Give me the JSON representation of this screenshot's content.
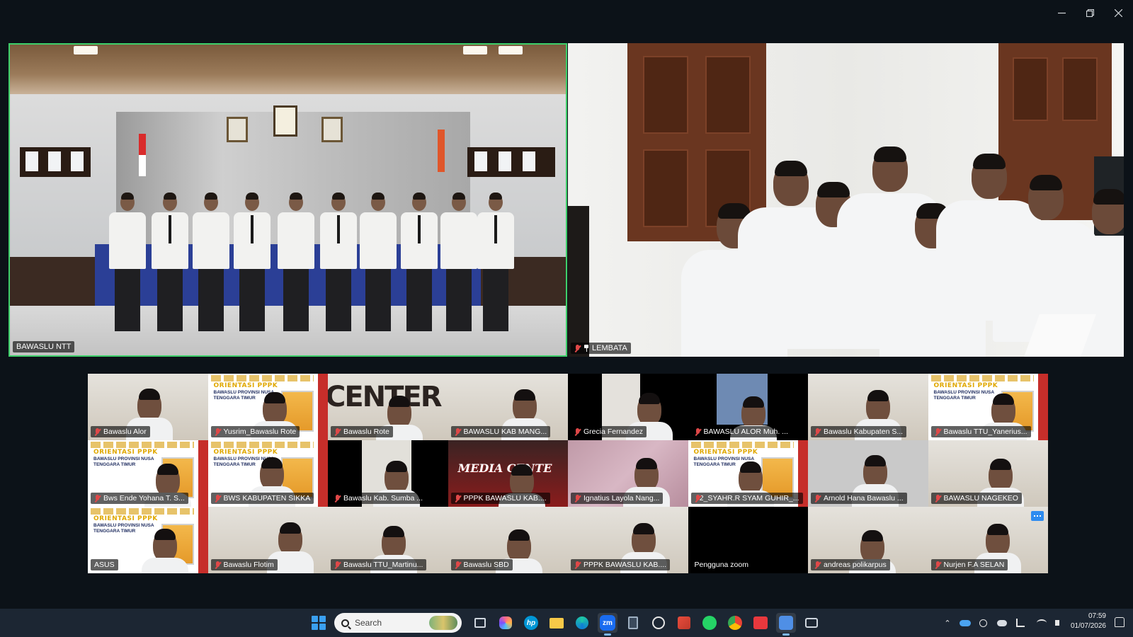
{
  "window": {
    "minimize_label": "—",
    "restore_label": "❐",
    "close_label": "✕"
  },
  "speakers": [
    {
      "name": "BAWASLU NTT",
      "active": true
    },
    {
      "name": "LEMBATA",
      "pinned": true,
      "muted": true
    }
  ],
  "gallery": [
    {
      "name": "Bawaslu  Alor",
      "muted": true
    },
    {
      "name": "Yusrim_Bawaslu Rote",
      "muted": true
    },
    {
      "name": "Bawaslu Rote",
      "muted": true,
      "overlay_text": "CENTER"
    },
    {
      "name": "BAWASLU KAB MANG...",
      "muted": true
    },
    {
      "name": "Grecia Fernandez",
      "muted": true
    },
    {
      "name": "BAWASLU ALOR Muh. ...",
      "muted": true
    },
    {
      "name": "Bawaslu Kabupaten S...",
      "muted": true
    },
    {
      "name": "Bawaslu TTU_Yanerius...",
      "muted": true
    },
    {
      "name": "Bws Ende Yohana T. S...",
      "muted": true
    },
    {
      "name": "BWS KABUPATEN SIKKA",
      "muted": true
    },
    {
      "name": "Bawaslu Kab. Sumba ...",
      "muted": true
    },
    {
      "name": "PPPK BAWASLU KAB....",
      "muted": true,
      "overlay_text": "MEDIA CENTE"
    },
    {
      "name": "Ignatius Layola Nang...",
      "muted": true
    },
    {
      "name": "2_SYAHR.R SYAM GUHIR_...",
      "muted": true
    },
    {
      "name": "Arnold Hana Bawaslu ...",
      "muted": true
    },
    {
      "name": "BAWASLU NAGEKEO",
      "muted": true
    },
    {
      "name": "ASUS",
      "muted": false
    },
    {
      "name": "Bawaslu Flotim",
      "muted": true
    },
    {
      "name": "Bawaslu TTU_Martinu...",
      "muted": true
    },
    {
      "name": "Bawaslu SBD",
      "muted": true
    },
    {
      "name": "PPPK BAWASLU KAB....",
      "muted": true
    },
    {
      "name": "Pengguna zoom",
      "muted": false
    },
    {
      "name": "andreas polikarpus",
      "muted": true
    },
    {
      "name": "Nurjen F.A SELAN",
      "muted": true
    }
  ],
  "banner": {
    "title": "ORIENTASI PPPK",
    "subtitle": "BAWASLU PROVINSI NUSA TENGGARA TIMUR"
  },
  "taskbar": {
    "search_placeholder": "Search",
    "apps": [
      "task-view-icon",
      "copilot-icon",
      "hp-icon",
      "file-explorer-icon",
      "edge-icon",
      "zoom-icon",
      "calculator-icon",
      "clock-icon",
      "office-icon",
      "whatsapp-icon",
      "chrome-icon",
      "wps-icon",
      "pen-app-icon",
      "camera-icon"
    ],
    "zoom_label": "zm",
    "hp_label": "hp",
    "time": "07:59",
    "date": "01/07/2026"
  },
  "colors": {
    "active_speaker_border": "#3ecf6a",
    "mute_red": "#e04848",
    "accent_blue": "#2e8cf0"
  }
}
